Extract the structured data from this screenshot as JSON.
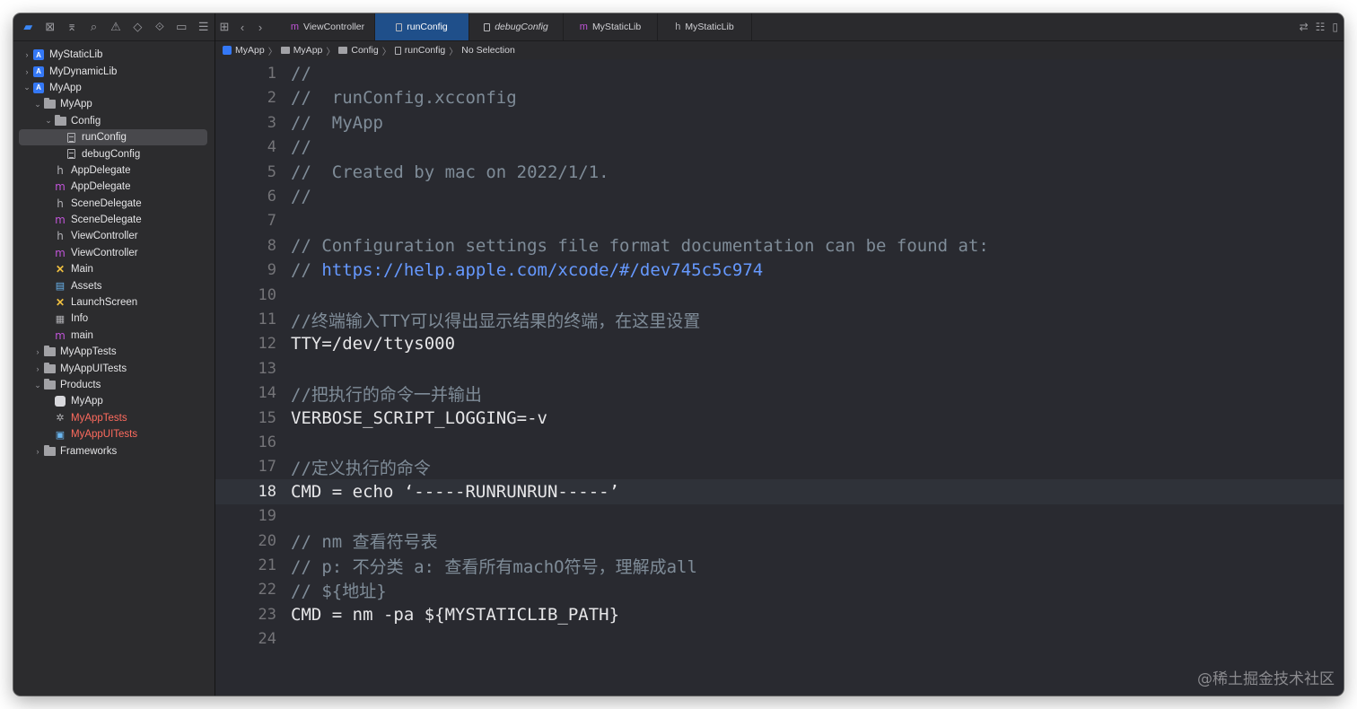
{
  "sidebar": {
    "nav_icons": [
      "folder-icon",
      "source-control-icon",
      "hierarchy-icon",
      "search-icon",
      "warning-icon",
      "test-icon",
      "debug-icon",
      "breakpoint-icon",
      "report-icon"
    ],
    "items": [
      {
        "label": "MyStaticLib",
        "indent": 0,
        "disclosure": "›",
        "icon": "project",
        "style": ""
      },
      {
        "label": "MyDynamicLib",
        "indent": 0,
        "disclosure": "›",
        "icon": "project",
        "style": ""
      },
      {
        "label": "MyApp",
        "indent": 0,
        "disclosure": "⌄",
        "icon": "project",
        "style": ""
      },
      {
        "label": "MyApp",
        "indent": 1,
        "disclosure": "⌄",
        "icon": "folder",
        "style": ""
      },
      {
        "label": "Config",
        "indent": 2,
        "disclosure": "⌄",
        "icon": "folder",
        "style": ""
      },
      {
        "label": "runConfig",
        "indent": 3,
        "disclosure": "",
        "icon": "file",
        "style": "selected"
      },
      {
        "label": "debugConfig",
        "indent": 3,
        "disclosure": "",
        "icon": "file",
        "style": ""
      },
      {
        "label": "AppDelegate",
        "indent": 2,
        "disclosure": "",
        "icon": "h",
        "style": ""
      },
      {
        "label": "AppDelegate",
        "indent": 2,
        "disclosure": "",
        "icon": "m",
        "style": ""
      },
      {
        "label": "SceneDelegate",
        "indent": 2,
        "disclosure": "",
        "icon": "h",
        "style": ""
      },
      {
        "label": "SceneDelegate",
        "indent": 2,
        "disclosure": "",
        "icon": "m",
        "style": ""
      },
      {
        "label": "ViewController",
        "indent": 2,
        "disclosure": "",
        "icon": "h",
        "style": ""
      },
      {
        "label": "ViewController",
        "indent": 2,
        "disclosure": "",
        "icon": "m",
        "style": ""
      },
      {
        "label": "Main",
        "indent": 2,
        "disclosure": "",
        "icon": "x",
        "style": ""
      },
      {
        "label": "Assets",
        "indent": 2,
        "disclosure": "",
        "icon": "assets",
        "style": ""
      },
      {
        "label": "LaunchScreen",
        "indent": 2,
        "disclosure": "",
        "icon": "x",
        "style": ""
      },
      {
        "label": "Info",
        "indent": 2,
        "disclosure": "",
        "icon": "info",
        "style": ""
      },
      {
        "label": "main",
        "indent": 2,
        "disclosure": "",
        "icon": "m",
        "style": ""
      },
      {
        "label": "MyAppTests",
        "indent": 1,
        "disclosure": "›",
        "icon": "folder",
        "style": ""
      },
      {
        "label": "MyAppUITests",
        "indent": 1,
        "disclosure": "›",
        "icon": "folder",
        "style": ""
      },
      {
        "label": "Products",
        "indent": 1,
        "disclosure": "⌄",
        "icon": "folder",
        "style": ""
      },
      {
        "label": "MyApp",
        "indent": 2,
        "disclosure": "",
        "icon": "app",
        "style": ""
      },
      {
        "label": "MyAppTests",
        "indent": 2,
        "disclosure": "",
        "icon": "test-bundle",
        "style": "red"
      },
      {
        "label": "MyAppUITests",
        "indent": 2,
        "disclosure": "",
        "icon": "ui-test-bundle",
        "style": "red"
      },
      {
        "label": "Frameworks",
        "indent": 1,
        "disclosure": "›",
        "icon": "folder",
        "style": ""
      }
    ]
  },
  "tabs": [
    {
      "label": "ViewController",
      "icon": "m",
      "active": false,
      "italic": false
    },
    {
      "label": "runConfig",
      "icon": "file",
      "active": true,
      "italic": false
    },
    {
      "label": "debugConfig",
      "icon": "file",
      "active": false,
      "italic": true
    },
    {
      "label": "MyStaticLib",
      "icon": "m",
      "active": false,
      "italic": false
    },
    {
      "label": "MyStaticLib",
      "icon": "h",
      "active": false,
      "italic": false
    }
  ],
  "breadcrumb": [
    {
      "label": "MyApp",
      "icon": "project"
    },
    {
      "label": "MyApp",
      "icon": "folder"
    },
    {
      "label": "Config",
      "icon": "folder"
    },
    {
      "label": "runConfig",
      "icon": "file"
    },
    {
      "label": "No Selection",
      "icon": ""
    }
  ],
  "editor": {
    "current_line": 18,
    "lines": [
      {
        "n": "1",
        "text": "//",
        "kind": "comment"
      },
      {
        "n": "2",
        "text": "//  runConfig.xcconfig",
        "kind": "comment"
      },
      {
        "n": "3",
        "text": "//  MyApp",
        "kind": "comment"
      },
      {
        "n": "4",
        "text": "//",
        "kind": "comment"
      },
      {
        "n": "5",
        "text": "//  Created by mac on 2022/1/1.",
        "kind": "comment"
      },
      {
        "n": "6",
        "text": "//",
        "kind": "comment"
      },
      {
        "n": "7",
        "text": "",
        "kind": "code"
      },
      {
        "n": "8",
        "text": "// Configuration settings file format documentation can be found at:",
        "kind": "comment"
      },
      {
        "n": "9",
        "text": "// ",
        "link": "https://help.apple.com/xcode/#/dev745c5c974",
        "kind": "comment"
      },
      {
        "n": "10",
        "text": "",
        "kind": "code"
      },
      {
        "n": "11",
        "text": "//终端输入TTY可以得出显示结果的终端，在这里设置",
        "kind": "comment"
      },
      {
        "n": "12",
        "text": "TTY=/dev/ttys000",
        "kind": "code"
      },
      {
        "n": "13",
        "text": "",
        "kind": "code"
      },
      {
        "n": "14",
        "text": "//把执行的命令一并输出",
        "kind": "comment"
      },
      {
        "n": "15",
        "text": "VERBOSE_SCRIPT_LOGGING=-v",
        "kind": "code"
      },
      {
        "n": "16",
        "text": "",
        "kind": "code"
      },
      {
        "n": "17",
        "text": "//定义执行的命令",
        "kind": "comment"
      },
      {
        "n": "18",
        "text": "CMD = echo ‘-----RUNRUNRUN-----’",
        "kind": "code"
      },
      {
        "n": "19",
        "text": "",
        "kind": "code"
      },
      {
        "n": "20",
        "text": "// nm 查看符号表",
        "kind": "comment"
      },
      {
        "n": "21",
        "text": "// p: 不分类 a: 查看所有machO符号，理解成all",
        "kind": "comment"
      },
      {
        "n": "22",
        "text": "// ${地址}",
        "kind": "comment"
      },
      {
        "n": "23",
        "text": "CMD = nm -pa ${MYSTATICLIB_PATH}",
        "kind": "code"
      },
      {
        "n": "24",
        "text": "",
        "kind": "code"
      }
    ]
  },
  "watermark": "@稀土掘金技术社区",
  "colors": {
    "accent": "#3478f6",
    "active_tab": "#1f4f8a",
    "comment": "#7f8c98",
    "link": "#6699ff",
    "editor_bg": "#292a30",
    "red_product": "#ff6b5e"
  }
}
